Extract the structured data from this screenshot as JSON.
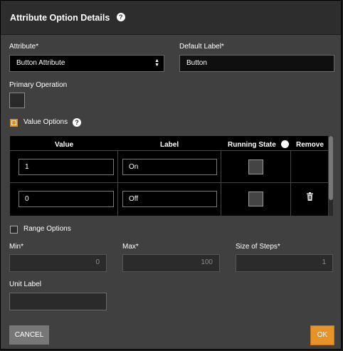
{
  "dialog": {
    "title": "Attribute Option Details"
  },
  "fields": {
    "attribute_label": "Attribute*",
    "attribute_value": "Button Attribute",
    "default_label_label": "Default Label*",
    "default_label_value": "Button",
    "primary_operation_label": "Primary Operation"
  },
  "value_options": {
    "label": "Value Options",
    "checked": true,
    "columns": [
      "Value",
      "Label",
      "Running State",
      "Remove"
    ],
    "rows": [
      {
        "value": "1",
        "label": "On",
        "running_state": false,
        "removable": false
      },
      {
        "value": "0",
        "label": "Off",
        "running_state": false,
        "removable": true
      }
    ]
  },
  "range_options": {
    "label": "Range Options",
    "checked": false,
    "min_label": "Min*",
    "min_value": "0",
    "max_label": "Max*",
    "max_value": "100",
    "steps_label": "Size of Steps*",
    "steps_value": "1",
    "unit_label": "Unit Label",
    "unit_value": ""
  },
  "buttons": {
    "cancel": "CANCEL",
    "ok": "OK"
  },
  "colors": {
    "accent": "#e6932a",
    "background": "#404040",
    "header": "#2d2d2d"
  },
  "icons": {
    "help": "?",
    "trash": "trash-icon"
  }
}
